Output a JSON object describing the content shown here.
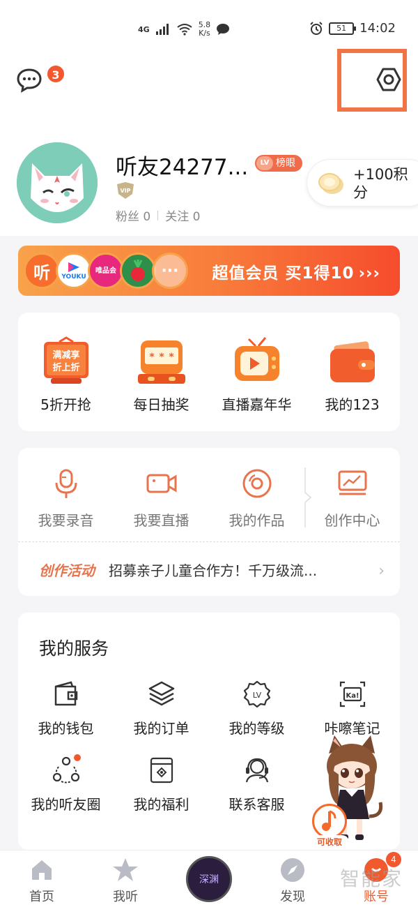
{
  "status_bar": {
    "network": "4G",
    "speed": "5.8\nK/s",
    "battery": "51",
    "time": "14:02"
  },
  "header": {
    "message_badge": "3"
  },
  "profile": {
    "username": "听友24277...",
    "lv_label": "LV",
    "rank_label": "榜眼",
    "vip_label": "VIP",
    "fans_label": "粉丝",
    "fans_count": "0",
    "follow_label": "关注",
    "follow_count": "0",
    "points_text": "+100积分"
  },
  "vip_banner": {
    "logos": [
      "听",
      "YOUKU",
      "唯品会",
      "",
      "···"
    ],
    "text": "超值会员 买1得10",
    "arrow": "›››"
  },
  "promo_items": [
    {
      "label": "5折开抢",
      "icon": "discount-sign-icon",
      "sign_text": "满减享\n折上折"
    },
    {
      "label": "每日抽奖",
      "icon": "slot-machine-icon"
    },
    {
      "label": "直播嘉年华",
      "icon": "tv-play-icon"
    },
    {
      "label": "我的123",
      "icon": "wallet-icon"
    }
  ],
  "creator_items": [
    {
      "label": "我要录音",
      "icon": "microphone-icon"
    },
    {
      "label": "我要直播",
      "icon": "video-camera-icon"
    },
    {
      "label": "我的作品",
      "icon": "disc-icon"
    },
    {
      "label": "创作中心",
      "icon": "chart-monitor-icon"
    }
  ],
  "activity": {
    "tag": "创作活动",
    "text": "招募亲子儿童合作方！千万级流..."
  },
  "services": {
    "title": "我的服务",
    "items": [
      {
        "label": "我的钱包",
        "icon": "wallet-outline-icon"
      },
      {
        "label": "我的订单",
        "icon": "layers-icon"
      },
      {
        "label": "我的等级",
        "icon": "level-badge-icon"
      },
      {
        "label": "咔嚓笔记",
        "icon": "ka-note-icon"
      },
      {
        "label": "我的听友圈",
        "icon": "friends-circle-icon"
      },
      {
        "label": "我的福利",
        "icon": "gift-box-icon"
      },
      {
        "label": "联系客服",
        "icon": "headset-icon"
      }
    ]
  },
  "floating": {
    "collect_label": "可收取"
  },
  "tabbar": {
    "items": [
      {
        "label": "首页",
        "icon": "home-icon"
      },
      {
        "label": "我听",
        "icon": "star-icon"
      },
      {
        "label": "",
        "icon": "now-playing-disc-icon"
      },
      {
        "label": "发现",
        "icon": "compass-icon"
      },
      {
        "label": "账号",
        "icon": "account-icon",
        "badge": "4"
      }
    ],
    "disc_text": "深渊"
  },
  "watermark": "智能家",
  "colors": {
    "accent": "#f05a2d",
    "highlight_box": "#f07446",
    "background": "#f5f5f7"
  }
}
